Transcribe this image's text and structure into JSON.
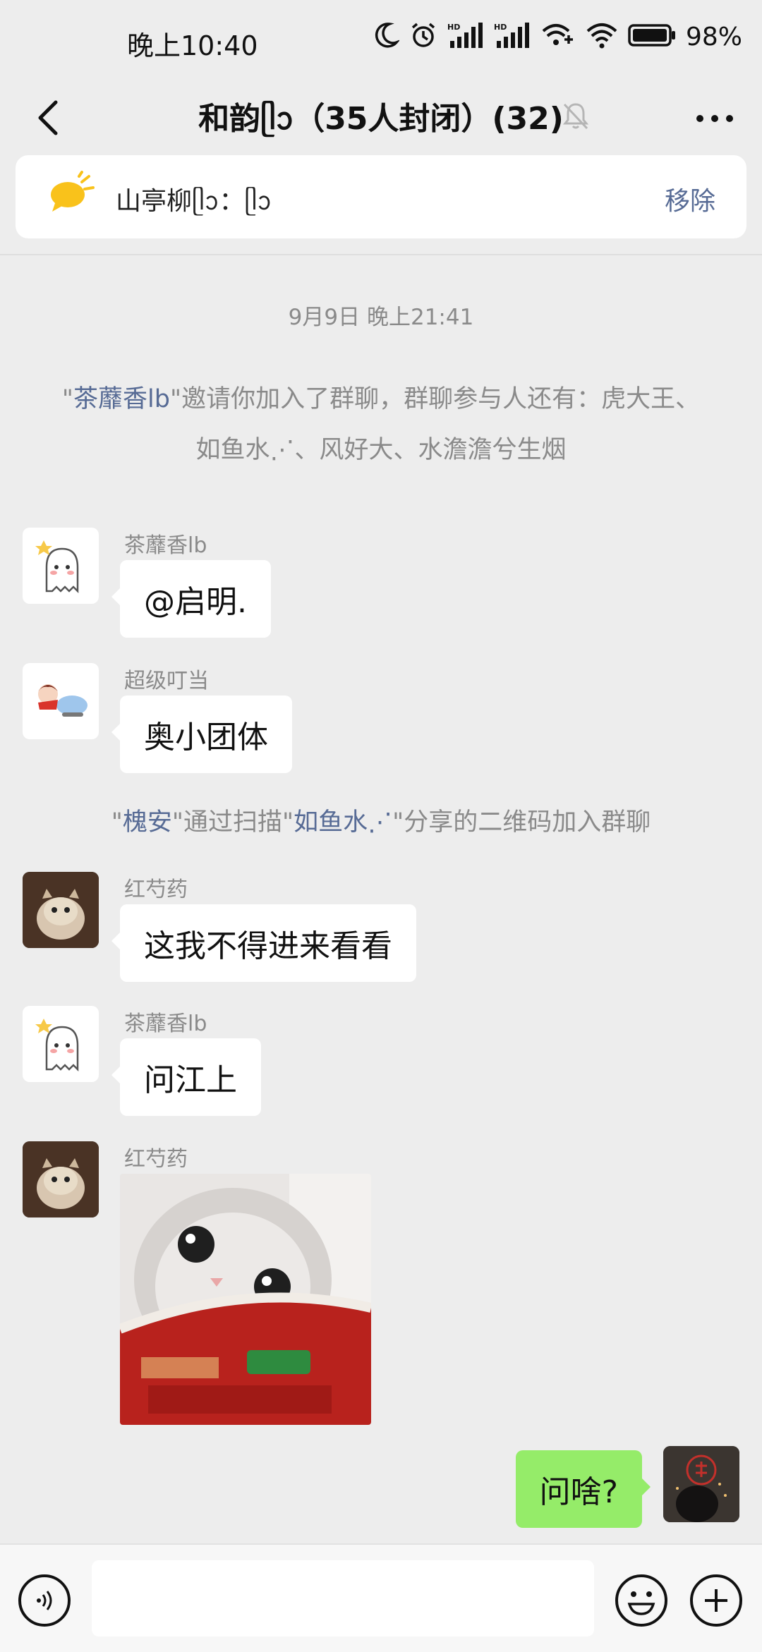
{
  "status_bar": {
    "time": "晚上10:40",
    "battery": "98%",
    "icons": [
      "moon-icon",
      "alarm-icon",
      "hd-signal-icon",
      "hd-signal-icon",
      "wifi-plus-icon",
      "wifi-icon",
      "battery-icon"
    ]
  },
  "header": {
    "title": "和韵ᥫᩣ（35人封闭）(32)",
    "back_icon": "chevron-left-icon",
    "mute_icon": "bell-off-icon",
    "more_icon": "more-icon"
  },
  "pinned": {
    "icon": "megaphone-icon",
    "text": "山亭柳ᥫᩣ：ᥫᩣ",
    "remove_label": "移除"
  },
  "timestamp": "9月9日 晚上21:41",
  "system_1": {
    "name": "茶蘼香lb",
    "quote_open": "\"",
    "quote_close": "\"",
    "rest": "邀请你加入了群聊，群聊参与人还有：虎大王、如鱼水⋰、风好大、水澹澹兮生烟"
  },
  "system_2": {
    "q1": "\"",
    "name_1": "槐安",
    "mid": "\"通过扫描\"",
    "name_2": "如鱼水⋰",
    "rest": "\"分享的二维码加入群聊"
  },
  "messages": [
    {
      "sender": "茶蘼香lb",
      "text": "@启明."
    },
    {
      "sender": "超级叮当",
      "text": "奥小团体"
    },
    {
      "sender": "红芍药",
      "text": "这我不得进来看看"
    },
    {
      "sender": "茶蘼香lb",
      "text": "问江上"
    },
    {
      "sender": "红芍药",
      "image": "cat-in-noodle-cup-sticker"
    }
  ],
  "my_message": {
    "text": "问啥?"
  },
  "input_bar": {
    "voice_icon": "voice-icon",
    "emoji_icon": "emoji-icon",
    "plus_icon": "plus-icon",
    "input_value": ""
  },
  "colors": {
    "background": "#ededed",
    "link": "#576b95",
    "my_bubble": "#95ec69",
    "muted_text": "#8a8a8a"
  }
}
